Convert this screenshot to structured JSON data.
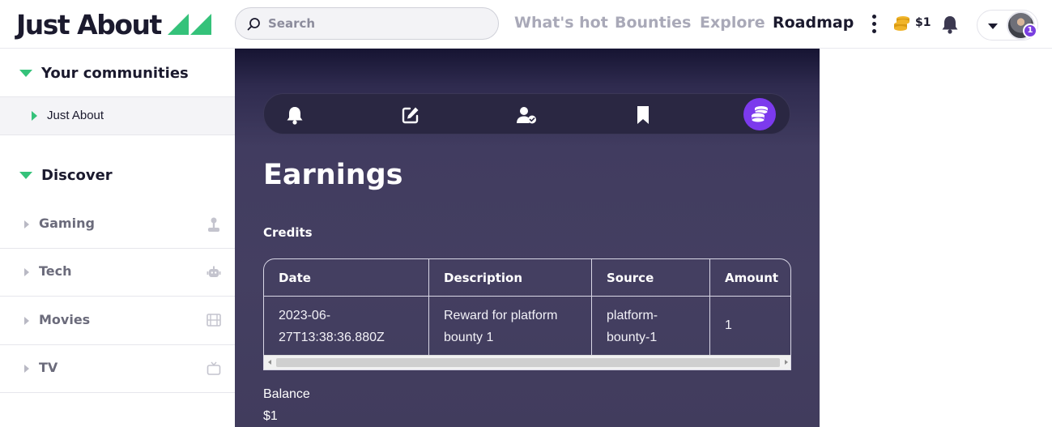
{
  "header": {
    "logo_text": "Just About",
    "search_placeholder": "Search",
    "nav": [
      "What's hot",
      "Bounties",
      "Explore",
      "Roadmap"
    ],
    "active_nav": "Roadmap",
    "balance": "$1",
    "avatar_badge": "1",
    "colors": {
      "accent_green": "#35c27a",
      "dark_text": "#1b1a2e",
      "nav_inactive": "#a9a9b8"
    }
  },
  "sidebar": {
    "communities_title": "Your communities",
    "communities": [
      {
        "label": "Just About"
      }
    ],
    "discover_title": "Discover",
    "discover": [
      {
        "label": "Gaming",
        "icon": "joystick-icon"
      },
      {
        "label": "Tech",
        "icon": "robot-icon"
      },
      {
        "label": "Movies",
        "icon": "film-icon"
      },
      {
        "label": "TV",
        "icon": "tv-icon"
      }
    ]
  },
  "main": {
    "tabs": [
      {
        "name": "notifications",
        "icon": "bell-icon"
      },
      {
        "name": "posts",
        "icon": "edit-icon"
      },
      {
        "name": "following",
        "icon": "user-check-icon"
      },
      {
        "name": "saved",
        "icon": "bookmark-icon"
      },
      {
        "name": "earnings",
        "icon": "coins-icon",
        "active": true
      }
    ],
    "title": "Earnings",
    "credits_label": "Credits",
    "table": {
      "headers": [
        "Date",
        "Description",
        "Source",
        "Amount"
      ],
      "rows": [
        {
          "date_line1": "2023-06-",
          "date_line2": "27T13:38:36.880Z",
          "desc_line1": "Reward for platform",
          "desc_line2": "bounty 1",
          "source_line1": "platform-",
          "source_line2": "bounty-1",
          "amount": "1"
        }
      ]
    },
    "balance_label": "Balance",
    "balance_value": "$1",
    "colors": {
      "panel_bg": "#443f61",
      "active_tab": "#7c3aed",
      "text": "#ffffff"
    }
  }
}
